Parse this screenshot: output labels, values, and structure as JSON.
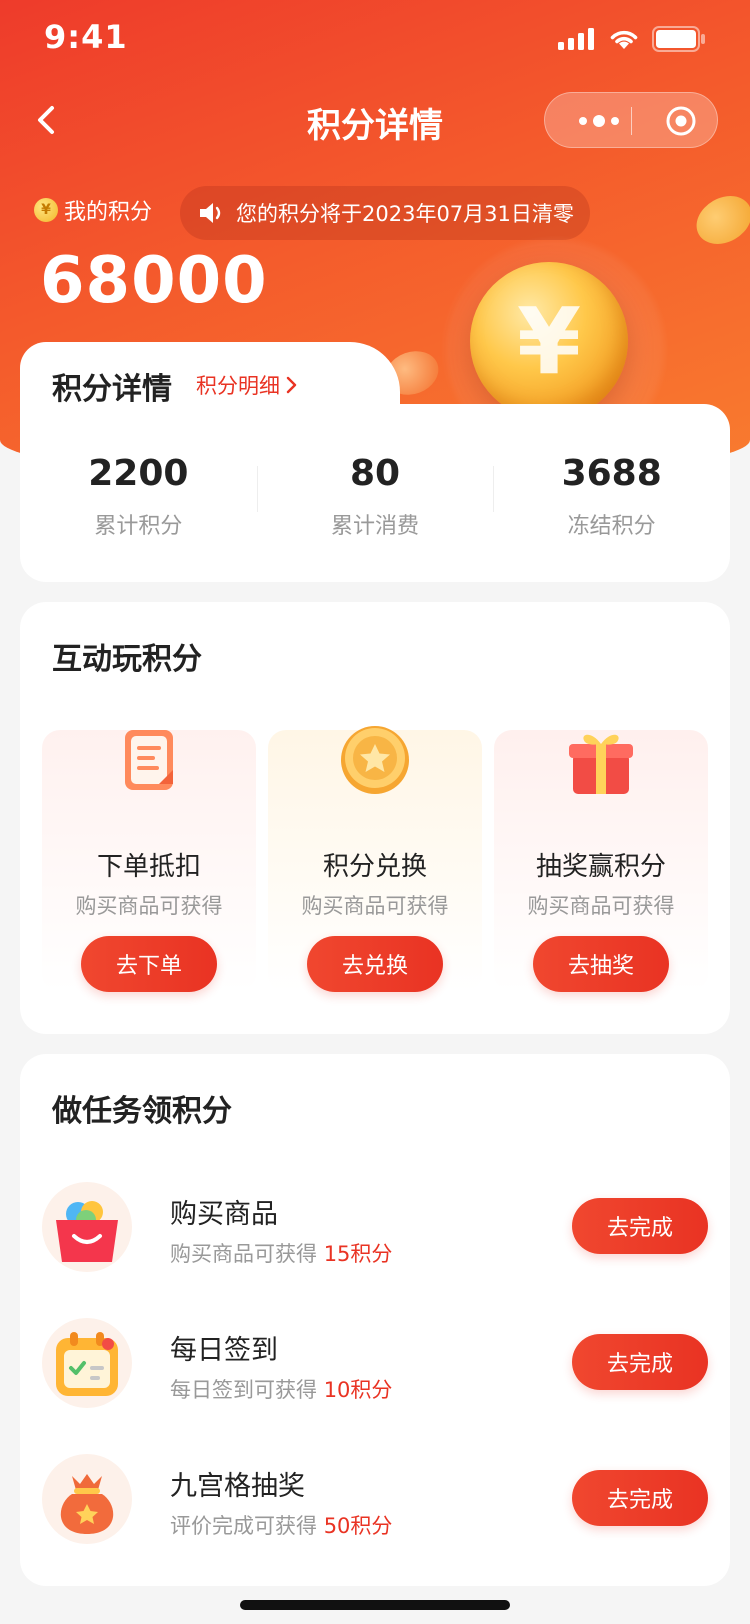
{
  "status": {
    "time": "9:41"
  },
  "nav": {
    "title": "积分详情"
  },
  "header": {
    "points_label": "我的积分",
    "coin_glyph": "¥",
    "notice": "您的积分将于2023年07月31日清零",
    "points_value": "68000",
    "big_coin_glyph": "¥"
  },
  "summary": {
    "title": "积分详情",
    "link_label": "积分明细",
    "stats": [
      {
        "value": "2200",
        "label": "累计积分"
      },
      {
        "value": "80",
        "label": "累计消费"
      },
      {
        "value": "3688",
        "label": "冻结积分"
      }
    ]
  },
  "interact": {
    "title": "互动玩积分",
    "items": [
      {
        "name": "下单抵扣",
        "desc": "购买商品可获得",
        "button": "去下单",
        "icon": "clipboard-icon"
      },
      {
        "name": "积分兑换",
        "desc": "购买商品可获得",
        "button": "去兑换",
        "icon": "star-coin-icon"
      },
      {
        "name": "抽奖赢积分",
        "desc": "购买商品可获得",
        "button": "去抽奖",
        "icon": "gift-box-icon"
      }
    ]
  },
  "tasks": {
    "title": "做任务领积分",
    "items": [
      {
        "name": "购买商品",
        "desc_prefix": "购买商品可获得 ",
        "reward": "15积分",
        "button": "去完成",
        "icon": "shopping-bag-icon"
      },
      {
        "name": "每日签到",
        "desc_prefix": "每日签到可获得 ",
        "reward": "10积分",
        "button": "去完成",
        "icon": "calendar-icon"
      },
      {
        "name": "九宫格抽奖",
        "desc_prefix": "评价完成可获得 ",
        "reward": "50积分",
        "button": "去完成",
        "icon": "lucky-bag-icon"
      }
    ]
  },
  "colors": {
    "brand": "#e93323",
    "hero_start": "#ee3b2b",
    "hero_end": "#f97c2f",
    "muted": "#999999"
  }
}
